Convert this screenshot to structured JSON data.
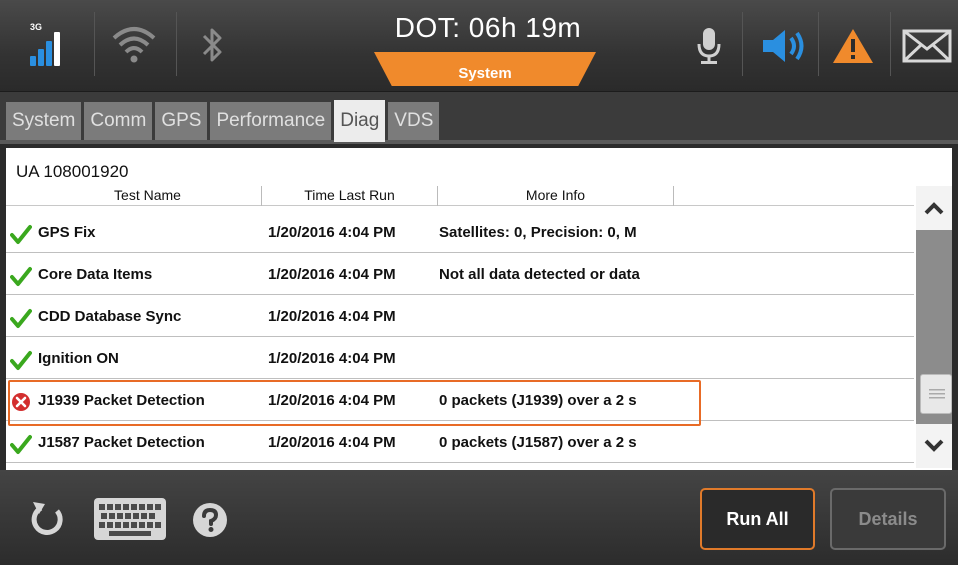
{
  "status_bar": {
    "network_label": "3G",
    "dot_title": "DOT: 06h 19m",
    "dot_subtitle": "System",
    "icons": [
      "signal-icon",
      "wifi-icon",
      "bluetooth-icon",
      "microphone-icon",
      "speaker-icon",
      "warning-icon",
      "mail-icon"
    ],
    "colors": {
      "accent": "#f08a2c",
      "speaker": "#2a8fe0",
      "warning": "#f08a2c"
    }
  },
  "tabs": [
    {
      "label": "System",
      "active": false
    },
    {
      "label": "Comm",
      "active": false
    },
    {
      "label": "GPS",
      "active": false
    },
    {
      "label": "Performance",
      "active": false
    },
    {
      "label": "Diag",
      "active": true
    },
    {
      "label": "VDS",
      "active": false
    }
  ],
  "diag": {
    "unit_id": "UA 108001920",
    "columns": [
      "Test Name",
      "Time Last Run",
      "More Info"
    ],
    "rows": [
      {
        "status": "pass",
        "name": "GPS Fix",
        "time": "1/20/2016 4:04 PM",
        "info": "Satellites: 0, Precision: 0, M"
      },
      {
        "status": "pass",
        "name": "Core Data Items",
        "time": "1/20/2016 4:04 PM",
        "info": "Not all data detected or data"
      },
      {
        "status": "pass",
        "name": "CDD Database Sync",
        "time": "1/20/2016 4:04 PM",
        "info": ""
      },
      {
        "status": "pass",
        "name": "Ignition ON",
        "time": "1/20/2016 4:04 PM",
        "info": ""
      },
      {
        "status": "fail",
        "name": "J1939 Packet Detection",
        "time": "1/20/2016 4:04 PM",
        "info": "0 packets (J1939) over a 2 s"
      },
      {
        "status": "pass",
        "name": "J1587 Packet Detection",
        "time": "1/20/2016 4:04 PM",
        "info": "0 packets (J1587) over a 2 s"
      }
    ]
  },
  "footer": {
    "icons": [
      "refresh-icon",
      "keyboard-icon",
      "help-icon"
    ],
    "run_all_label": "Run All",
    "details_label": "Details"
  }
}
